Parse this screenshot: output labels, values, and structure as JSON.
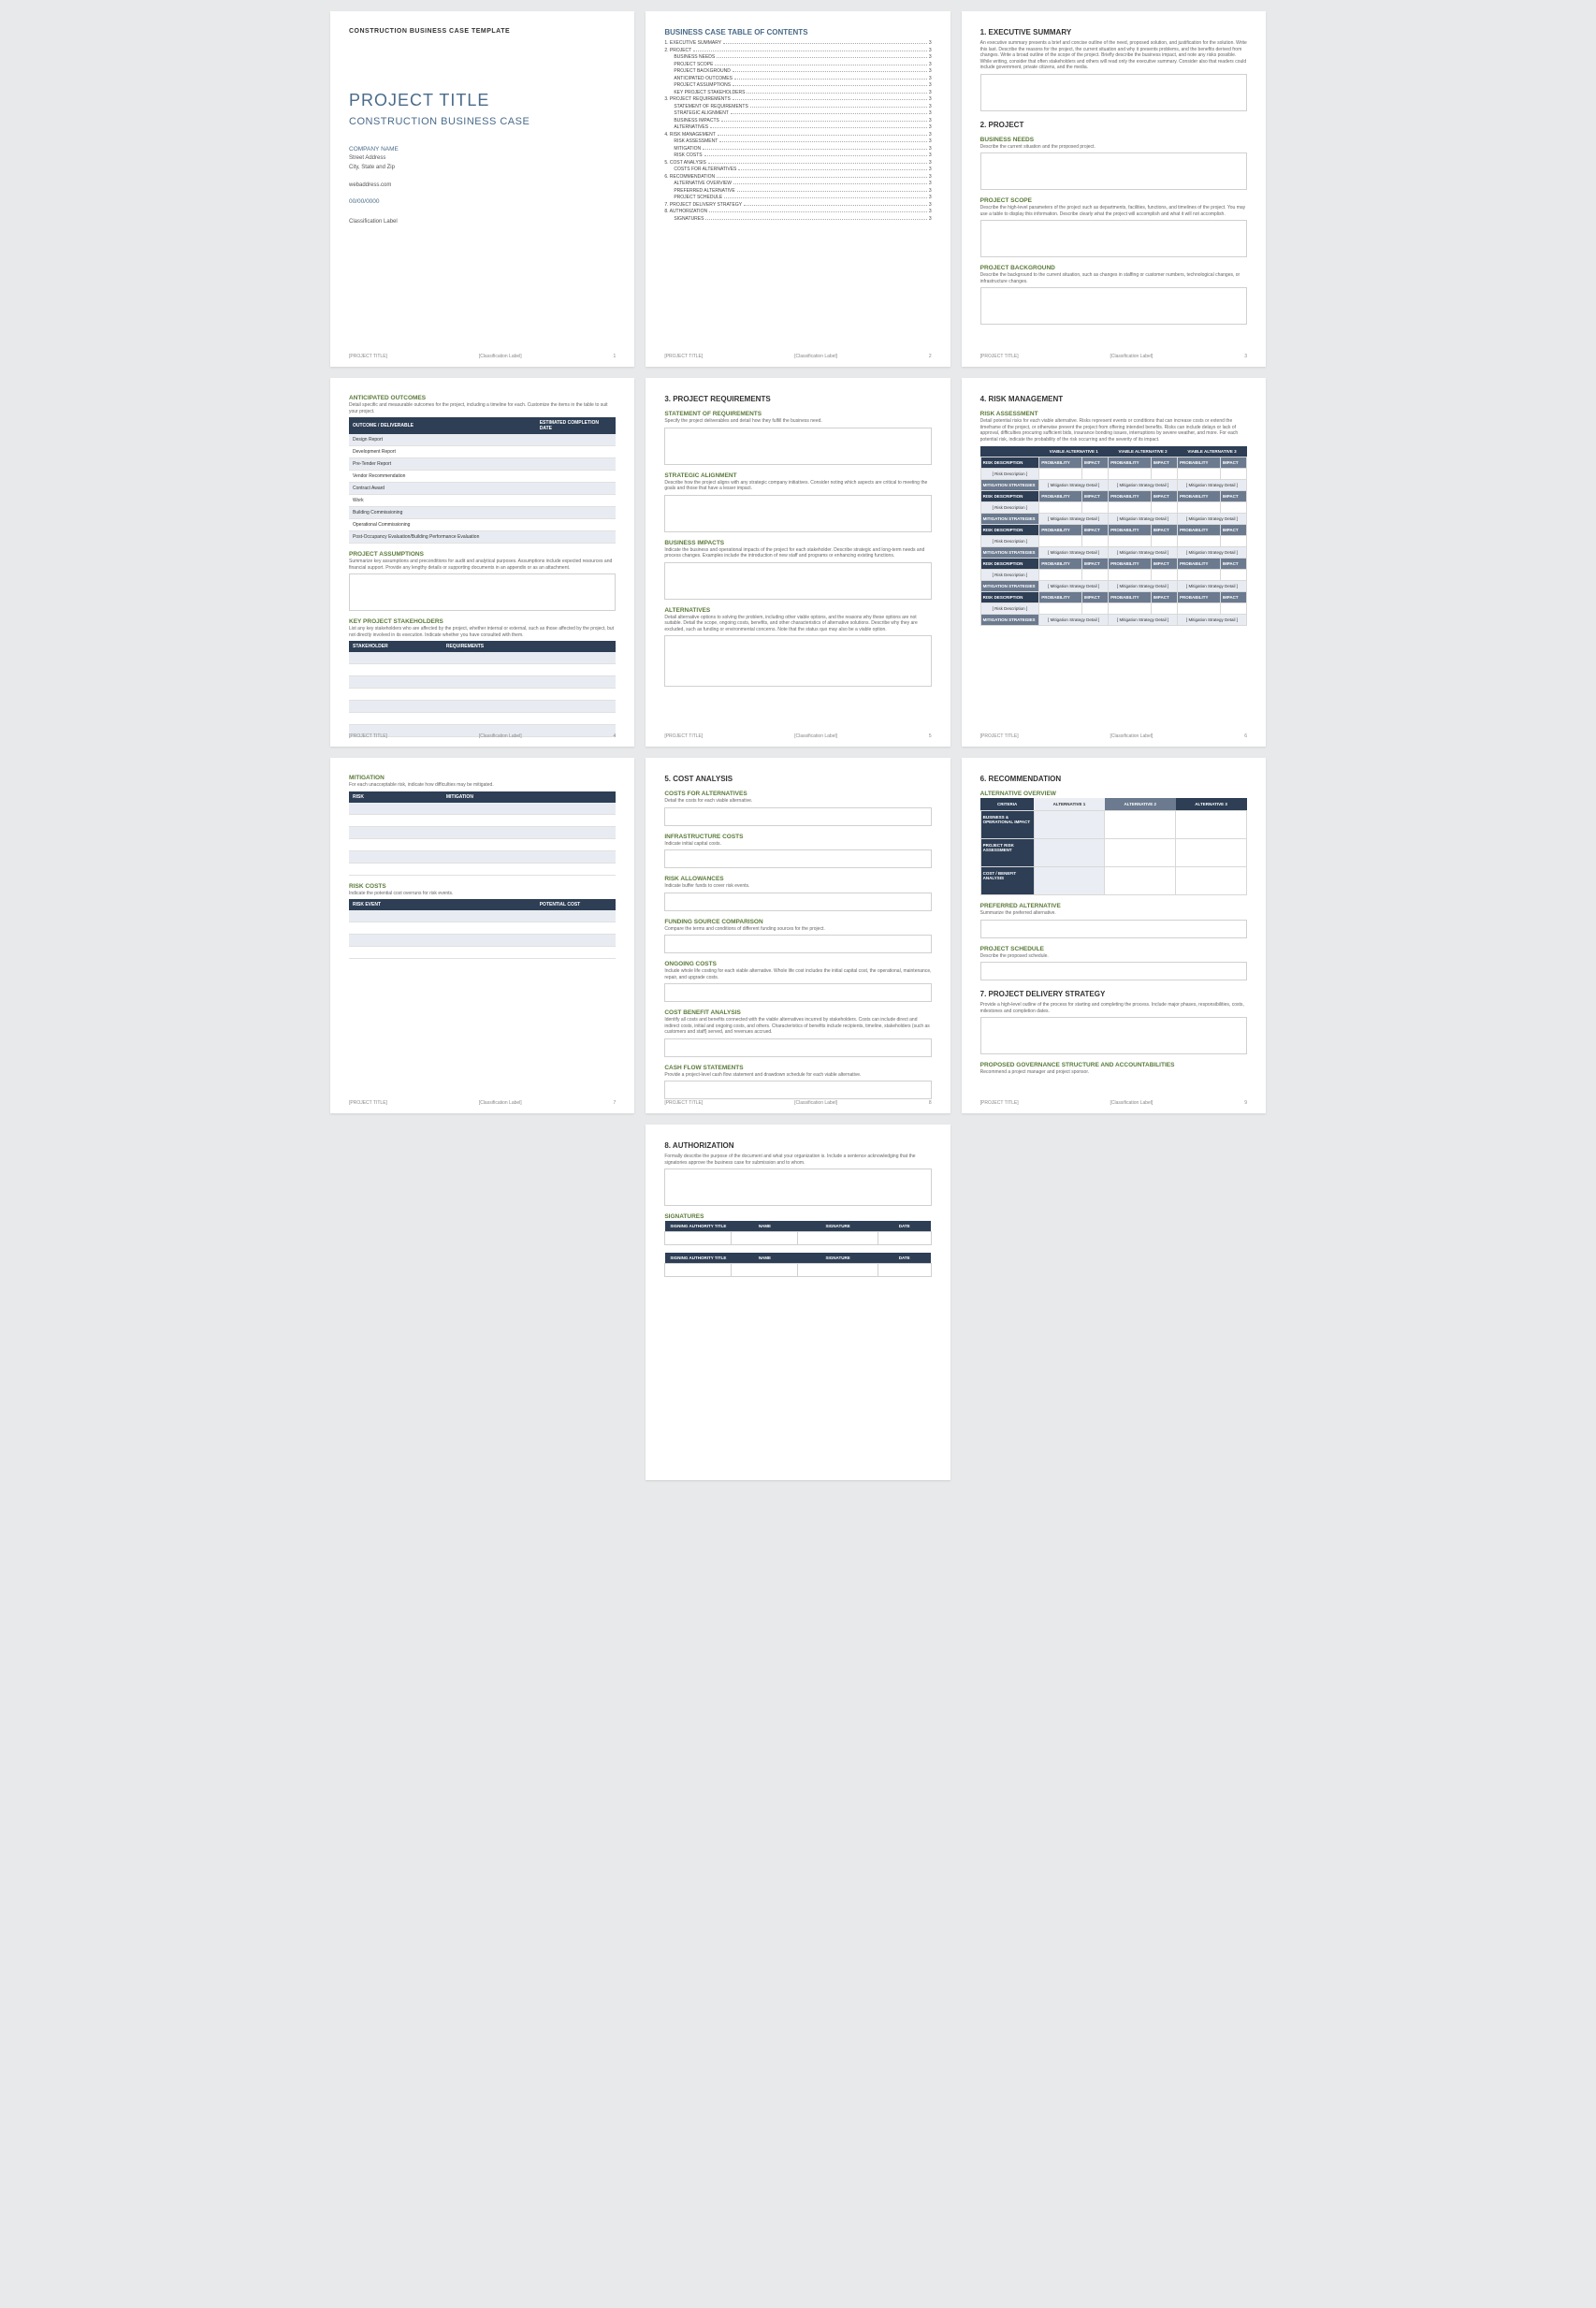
{
  "meta": {
    "header": "CONSTRUCTION BUSINESS CASE TEMPLATE",
    "projectTitle": "[PROJECT TITLE]",
    "classLabel": "[Classification Label]"
  },
  "cover": {
    "title": "PROJECT TITLE",
    "subtitle": "CONSTRUCTION BUSINESS CASE",
    "company": "COMPANY NAME",
    "addr1": "Street Address",
    "addr2": "City, State and Zip",
    "web": "webaddress.com",
    "date": "00/00/0000",
    "class": "Classification Label"
  },
  "toc": {
    "title": "BUSINESS CASE TABLE OF CONTENTS",
    "items": [
      {
        "t": "1.  EXECUTIVE SUMMARY",
        "p": "3",
        "i": 0
      },
      {
        "t": "2.  PROJECT",
        "p": "3",
        "i": 0
      },
      {
        "t": "BUSINESS NEEDS",
        "p": "3",
        "i": 1
      },
      {
        "t": "PROJECT SCOPE",
        "p": "3",
        "i": 1
      },
      {
        "t": "PROJECT BACKGROUND",
        "p": "3",
        "i": 1
      },
      {
        "t": "ANTICIPATED OUTCOMES",
        "p": "3",
        "i": 1
      },
      {
        "t": "PROJECT ASSUMPTIONS",
        "p": "3",
        "i": 1
      },
      {
        "t": "KEY PROJECT STAKEHOLDERS",
        "p": "3",
        "i": 1
      },
      {
        "t": "3.  PROJECT REQUIREMENTS",
        "p": "3",
        "i": 0
      },
      {
        "t": "STATEMENT OF REQUIREMENTS",
        "p": "3",
        "i": 1
      },
      {
        "t": "STRATEGIC ALIGNMENT",
        "p": "3",
        "i": 1
      },
      {
        "t": "BUSINESS IMPACTS",
        "p": "3",
        "i": 1
      },
      {
        "t": "ALTERNATIVES",
        "p": "3",
        "i": 1
      },
      {
        "t": "4.  RISK MANAGEMENT",
        "p": "3",
        "i": 0
      },
      {
        "t": "RISK ASSESSMENT",
        "p": "3",
        "i": 1
      },
      {
        "t": "MITIGATION",
        "p": "3",
        "i": 1
      },
      {
        "t": "RISK COSTS",
        "p": "3",
        "i": 1
      },
      {
        "t": "5.  COST ANALYSIS",
        "p": "3",
        "i": 0
      },
      {
        "t": "COSTS FOR ALTERNATIVES",
        "p": "3",
        "i": 1
      },
      {
        "t": "6.  RECOMMENDATION",
        "p": "3",
        "i": 0
      },
      {
        "t": "ALTERNATIVE OVERVIEW",
        "p": "3",
        "i": 1
      },
      {
        "t": "PREFERRED ALTERNATIVE",
        "p": "3",
        "i": 1
      },
      {
        "t": "PROJECT SCHEDULE",
        "p": "3",
        "i": 1
      },
      {
        "t": "7.  PROJECT DELIVERY STRATEGY",
        "p": "3",
        "i": 0
      },
      {
        "t": "8.  AUTHORIZATION",
        "p": "3",
        "i": 0
      },
      {
        "t": "SIGNATURES",
        "p": "3",
        "i": 1
      }
    ]
  },
  "p3": {
    "h1": "1. EXECUTIVE SUMMARY",
    "d1": "An executive summary presents a brief and concise outline of the need, proposed solution, and justification for the solution. Write this last. Describe the reasons for the project, the current situation and why it presents problems, and the benefits derived from changes. Write a broad outline of the scope of the project. Briefly describe the business impact, and note any risks possible. While writing, consider that often stakeholders and others will read only the executive summary. Consider also that readers could include government, private citizens, and the media.",
    "h2": "2. PROJECT",
    "s1": "BUSINESS NEEDS",
    "d2": "Describe the current situation and the proposed project.",
    "s2": "PROJECT SCOPE",
    "d3": "Describe the high-level parameters of the project such as departments, facilities, functions, and timelines of the project. You may use a table to display this information. Describe clearly what the project will accomplish and what it will not accomplish.",
    "s3": "PROJECT BACKGROUND",
    "d4": "Describe the background to the current situation, such as changes in staffing or customer numbers, technological changes, or infrastructure changes."
  },
  "p4": {
    "s1": "ANTICIPATED OUTCOMES",
    "d1": "Detail specific and measurable outcomes for the project, including a timeline for each. Customize the items in the table to suit your project.",
    "th1": "OUTCOME / DELIVERABLE",
    "th2": "ESTIMATED COMPLETION DATE",
    "rows": [
      "Design Report",
      "Development Report",
      "Pre-Tender Report",
      "Vendor Recommendation",
      "Contract Award",
      "Work",
      "Building Commissioning",
      "Operational Commissioning",
      "Post-Occupancy Evaluation/Building Performance Evaluation"
    ],
    "s2": "PROJECT ASSUMPTIONS",
    "d2": "Summarize key assumptions and preconditions for audit and analytical purposes. Assumptions include expected resources and financial support. Provide any lengthy details or supporting documents in an appendix or as an attachment.",
    "s3": "KEY PROJECT STAKEHOLDERS",
    "d3": "List any key stakeholders who are affected by the project, whether internal or external, such as those affected by the project, but not directly involved in its execution. Indicate whether you have consulted with them.",
    "th3": "STAKEHOLDER",
    "th4": "REQUIREMENTS"
  },
  "p5": {
    "h": "3. PROJECT REQUIREMENTS",
    "s1": "STATEMENT OF REQUIREMENTS",
    "d1": "Specify the project deliverables and detail how they fulfill the business need.",
    "s2": "STRATEGIC ALIGNMENT",
    "d2": "Describe how the project aligns with any strategic company initiatives. Consider noting which aspects are critical to meeting the goals and those that have a lesser impact.",
    "s3": "BUSINESS IMPACTS",
    "d3": "Indicate the business and operational impacts of the project for each stakeholder. Describe strategic and long-term needs and process changes. Examples include the introduction of new staff and programs or enhancing existing functions.",
    "s4": "ALTERNATIVES",
    "d4": "Detail alternative options to solving the problem, including other viable options, and the reasons why these options are not suitable. Detail the scope, ongoing costs, benefits, and other characteristics of alternative solutions. Describe why they are excluded, such as funding or environmental concerns. Note that the status quo may also be a viable option."
  },
  "p6": {
    "h": "4. RISK MANAGEMENT",
    "s1": "RISK ASSESSMENT",
    "d1": "Detail potential risks for each viable alternative. Risks represent events or conditions that can increase costs or extend the timeframe of the project, or otherwise prevent the project from offering intended benefits. Risks can include delays or lack of approval, difficulties procuring sufficient bids, insurance bonding issues, interruptions by severe weather, and more. For each potential risk, indicate the probability of the risk occurring and the severity of its impact.",
    "va1": "VIABLE ALTERNATIVE 1",
    "va2": "VIABLE ALTERNATIVE 2",
    "va3": "VIABLE ALTERNATIVE 3",
    "rd": "RISK DESCRIPTION",
    "prob": "PROBABILITY",
    "imp": "IMPACT",
    "ms": "MITIGATION STRATEGIES",
    "rdt": "[ Risk Description ]",
    "mst": "[ Mitigation Strategy Detail ]"
  },
  "p7": {
    "s1": "MITIGATION",
    "d1": "For each unacceptable risk, indicate how difficulties may be mitigated.",
    "th1": "RISK",
    "th2": "MITIGATION",
    "s2": "RISK COSTS",
    "d2": "Indicate the potential cost overruns for risk events.",
    "th3": "RISK EVENT",
    "th4": "POTENTIAL COST"
  },
  "p8": {
    "h": "5. COST ANALYSIS",
    "s1": "COSTS FOR ALTERNATIVES",
    "d1": "Detail the costs for each viable alternative.",
    "s2": "INFRASTRUCTURE COSTS",
    "d2": "Indicate initial capital costs.",
    "s3": "RISK ALLOWANCES",
    "d3": "Indicate buffer funds to cover risk events.",
    "s4": "FUNDING SOURCE COMPARISON",
    "d4": "Compare the terms and conditions of different funding sources for the project.",
    "s5": "ONGOING COSTS",
    "d5": "Include whole life costing for each viable alternative. Whole life cost includes the initial capital cost, the operational, maintenance, repair, and upgrade costs.",
    "s6": "COST BENEFIT ANALYSIS",
    "d6": "Identify all costs and benefits connected with the viable alternatives incurred by stakeholders. Costs can include direct and indirect costs, initial and ongoing costs, and others. Characteristics of benefits include recipients, timeline, stakeholders (such as customers and staff) served, and revenues accrued.",
    "s7": "CASH FLOW STATEMENTS",
    "d7": "Provide a project-level cash flow statement and drawdown schedule for each viable alternative."
  },
  "p9": {
    "h": "6. RECOMMENDATION",
    "s1": "ALTERNATIVE OVERVIEW",
    "crit": "CRITERIA",
    "a1": "ALTERNATIVE 1",
    "a2": "ALTERNATIVE 2",
    "a3": "ALTERNATIVE 3",
    "r1": "BUSINESS & OPERATIONAL IMPACT",
    "r2": "PROJECT RISK ASSESSMENT",
    "r3": "COST / BENEFIT ANALYSIS",
    "s2": "PREFERRED ALTERNATIVE",
    "d2": "Summarize the preferred alternative.",
    "s3": "PROJECT SCHEDULE",
    "d3": "Describe the proposed schedule.",
    "h2": "7. PROJECT DELIVERY STRATEGY",
    "d4": "Provide a high-level outline of the process for starting and completing the process. Include major phases, responsibilities, costs, milestones and completion dates.",
    "s4": "PROPOSED GOVERNANCE STRUCTURE AND ACCOUNTABILITIES",
    "d5": "Recommend a project manager and project sponsor."
  },
  "p10": {
    "h": "8. AUTHORIZATION",
    "d1": "Formally describe the purpose of the document and what your organization is. Include a sentence acknowledging that the signatories approve the business case for submission and to whom.",
    "s1": "SIGNATURES",
    "th1": "SIGNING AUTHORITY TITLE",
    "th2": "NAME",
    "th3": "SIGNATURE",
    "th4": "DATE"
  },
  "pg": {
    "1": "1",
    "2": "2",
    "3": "3",
    "4": "4",
    "5": "5",
    "6": "6",
    "7": "7",
    "8": "8",
    "9": "9"
  }
}
